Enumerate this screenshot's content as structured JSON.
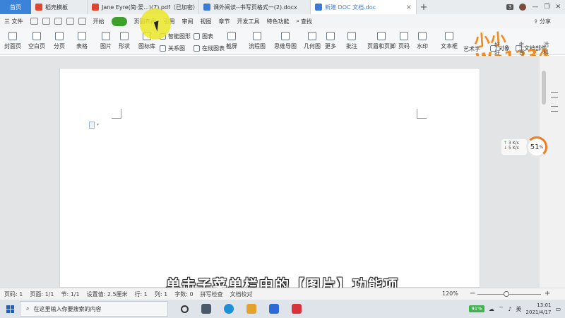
{
  "tabs": [
    {
      "label": "首页",
      "icon": "home-tab",
      "active": false,
      "color": "#3b82d9"
    },
    {
      "label": "稻壳模板",
      "icon": "docer-icon",
      "color": "#e0462e"
    },
    {
      "label": "Jane Eyre(简·爱...)(7).pdf（已加密）",
      "icon": "pdf-icon",
      "color": "#e0462e"
    },
    {
      "label": "课外阅读--书写页格式一(2).docx",
      "icon": "word-icon",
      "color": "#3b7bd4"
    },
    {
      "label": "新建 DOC 文档.doc",
      "icon": "word-icon",
      "active": true,
      "color": "#3b7bd4"
    }
  ],
  "tabbar_right": {
    "badge": "3"
  },
  "menu": {
    "file": "三 文件",
    "items": [
      "开始",
      "页面布局",
      "引用",
      "审阅",
      "视图",
      "章节",
      "开发工具",
      "特色功能"
    ],
    "search": "查找",
    "share": "分享",
    "active_item_color": "#3ca02a"
  },
  "ribbon": {
    "large": [
      {
        "label": "封面页",
        "icon": "cover-page-icon"
      },
      {
        "label": "空白页",
        "icon": "blank-page-icon"
      },
      {
        "label": "分页",
        "icon": "page-break-icon"
      },
      {
        "label": "表格",
        "icon": "table-icon"
      },
      {
        "label": "图片",
        "icon": "picture-icon"
      },
      {
        "label": "形状",
        "icon": "shape-icon"
      },
      {
        "label": "图标库",
        "icon": "icon-library-icon"
      },
      {
        "label": "流程图",
        "icon": "flowchart-icon"
      },
      {
        "label": "思维导图",
        "icon": "mindmap-icon"
      },
      {
        "label": "几何图",
        "icon": "geometry-icon"
      },
      {
        "label": "更多",
        "icon": "more-icon"
      },
      {
        "label": "批注",
        "icon": "comment-icon"
      },
      {
        "label": "页眉和页脚",
        "icon": "header-footer-icon"
      },
      {
        "label": "页码",
        "icon": "page-number-icon"
      },
      {
        "label": "水印",
        "icon": "watermark-icon"
      },
      {
        "label": "文本框",
        "icon": "textbox-icon"
      },
      {
        "label": "艺术字",
        "icon": "wordart-icon"
      }
    ],
    "small": [
      {
        "label": "智能图形",
        "icon": "smart-graphic-icon"
      },
      {
        "label": "关系图",
        "icon": "relation-chart-icon"
      },
      {
        "label": "图表",
        "icon": "chart-icon"
      },
      {
        "label": "在线图表",
        "icon": "online-chart-icon"
      },
      {
        "label": "截屏",
        "icon": "screenshot-icon"
      },
      {
        "label": "对象",
        "icon": "object-icon"
      },
      {
        "label": "文档部件",
        "icon": "doc-parts-icon"
      }
    ]
  },
  "logo": {
    "text": "小小Wo1234",
    "sub": "好 生 活 好 百 科",
    "color": "#f08a1c"
  },
  "speed": {
    "up": "3",
    "down": "5",
    "unit": "K/s",
    "percent": "51",
    "percent_sign": "%"
  },
  "subtitle": "单击子菜单栏中的【图片】功能项",
  "status": {
    "page_code": "页码: 1",
    "pages": "页面: 1/1",
    "section": "节: 1/1",
    "settings": "设置值: 2.5厘米",
    "row": "行: 1",
    "col": "列: 1",
    "words": "字数: 0",
    "spell": "拼写检查",
    "proof": "文档校对",
    "zoom": "120%",
    "zoom_level": 0.45
  },
  "taskbar": {
    "search_placeholder": "在这里输入你要搜索的内容",
    "battery": "91%",
    "lang": "英",
    "time": "13:01",
    "date": "2021/4/17"
  }
}
